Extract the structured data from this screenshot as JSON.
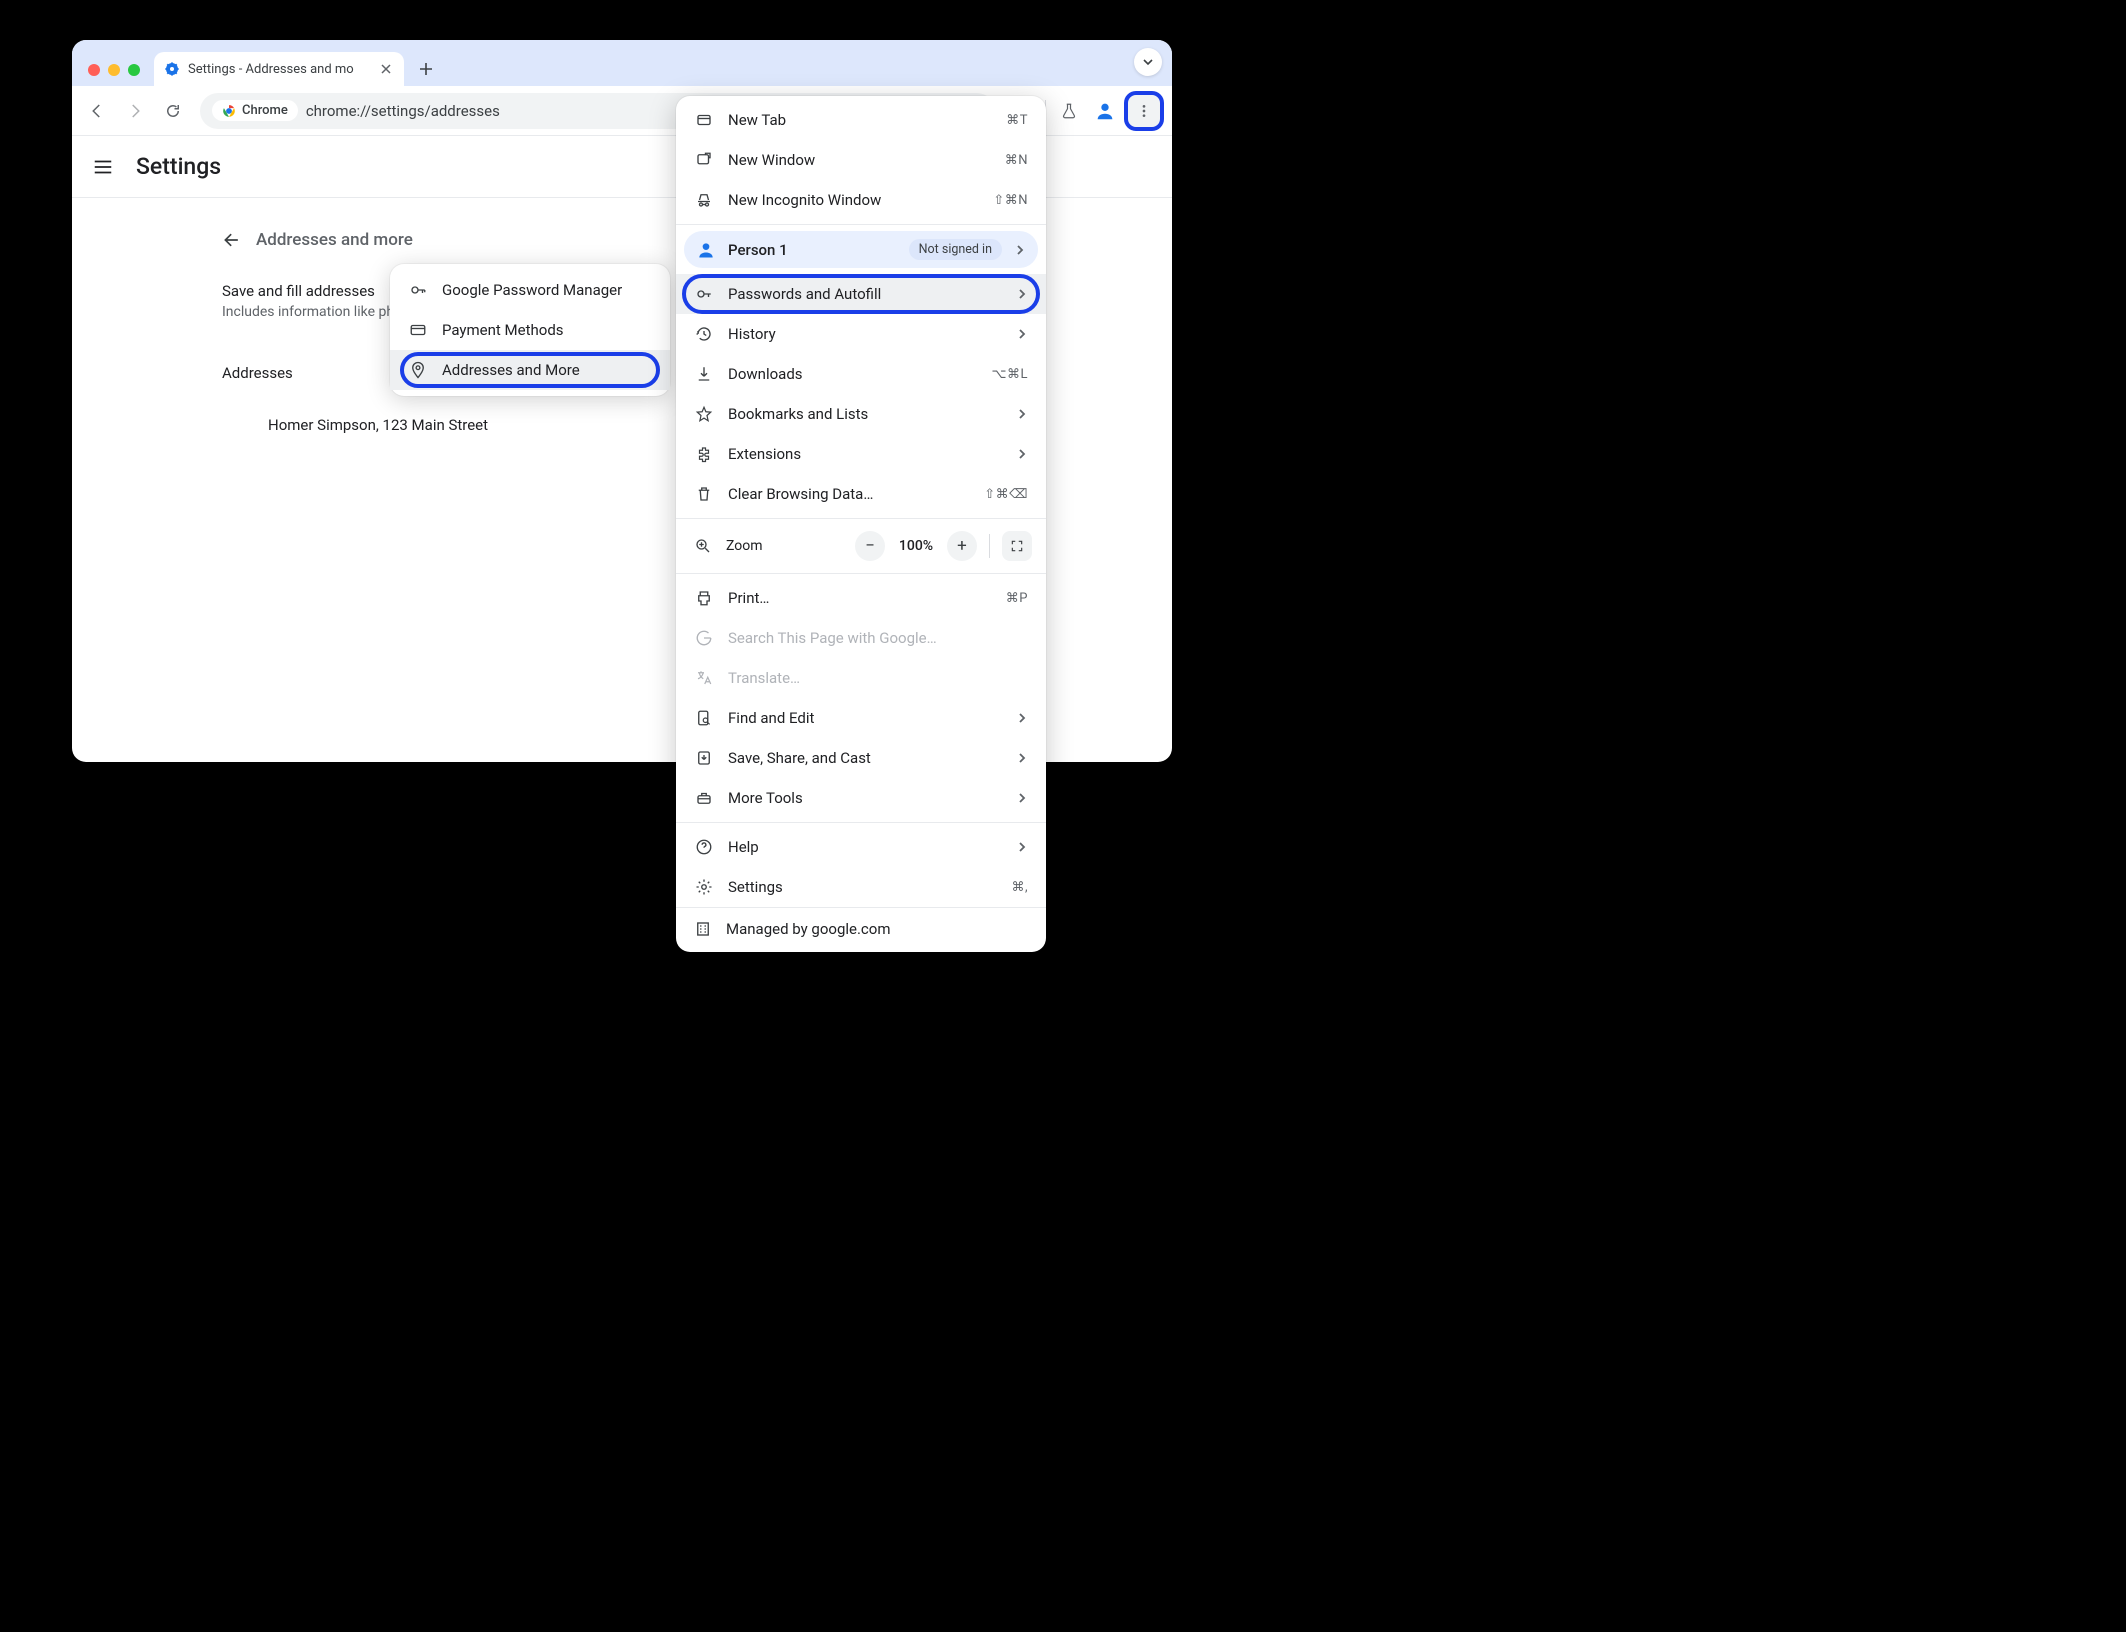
{
  "tab": {
    "title": "Settings - Addresses and mo"
  },
  "toolbar": {
    "chrome_chip": "Chrome",
    "url": "chrome://settings/addresses"
  },
  "page": {
    "title": "Settings",
    "section": "Addresses and more",
    "setting_label": "Save and fill addresses",
    "setting_desc": "Includes information like phon",
    "addresses_heading": "Addresses",
    "address_entry": "Homer Simpson, 123 Main Street"
  },
  "submenu": {
    "items": [
      {
        "label": "Google Password Manager"
      },
      {
        "label": "Payment Methods"
      },
      {
        "label": "Addresses and More",
        "highlighted": true
      }
    ]
  },
  "chrome_menu": {
    "new_tab": {
      "label": "New Tab",
      "shortcut": "⌘T"
    },
    "new_window": {
      "label": "New Window",
      "shortcut": "⌘N"
    },
    "new_incognito": {
      "label": "New Incognito Window",
      "shortcut": "⇧⌘N"
    },
    "profile": {
      "name": "Person 1",
      "status": "Not signed in"
    },
    "passwords": {
      "label": "Passwords and Autofill"
    },
    "history": {
      "label": "History"
    },
    "downloads": {
      "label": "Downloads",
      "shortcut": "⌥⌘L"
    },
    "bookmarks": {
      "label": "Bookmarks and Lists"
    },
    "extensions": {
      "label": "Extensions"
    },
    "clear_data": {
      "label": "Clear Browsing Data…",
      "shortcut": "⇧⌘⌫"
    },
    "zoom": {
      "label": "Zoom",
      "percent": "100%"
    },
    "print": {
      "label": "Print…",
      "shortcut": "⌘P"
    },
    "search_page": {
      "label": "Search This Page with Google…"
    },
    "translate": {
      "label": "Translate…"
    },
    "find_edit": {
      "label": "Find and Edit"
    },
    "save_share": {
      "label": "Save, Share, and Cast"
    },
    "more_tools": {
      "label": "More Tools"
    },
    "help": {
      "label": "Help"
    },
    "settings": {
      "label": "Settings",
      "shortcut": "⌘,"
    },
    "managed": {
      "label": "Managed by google.com"
    }
  }
}
